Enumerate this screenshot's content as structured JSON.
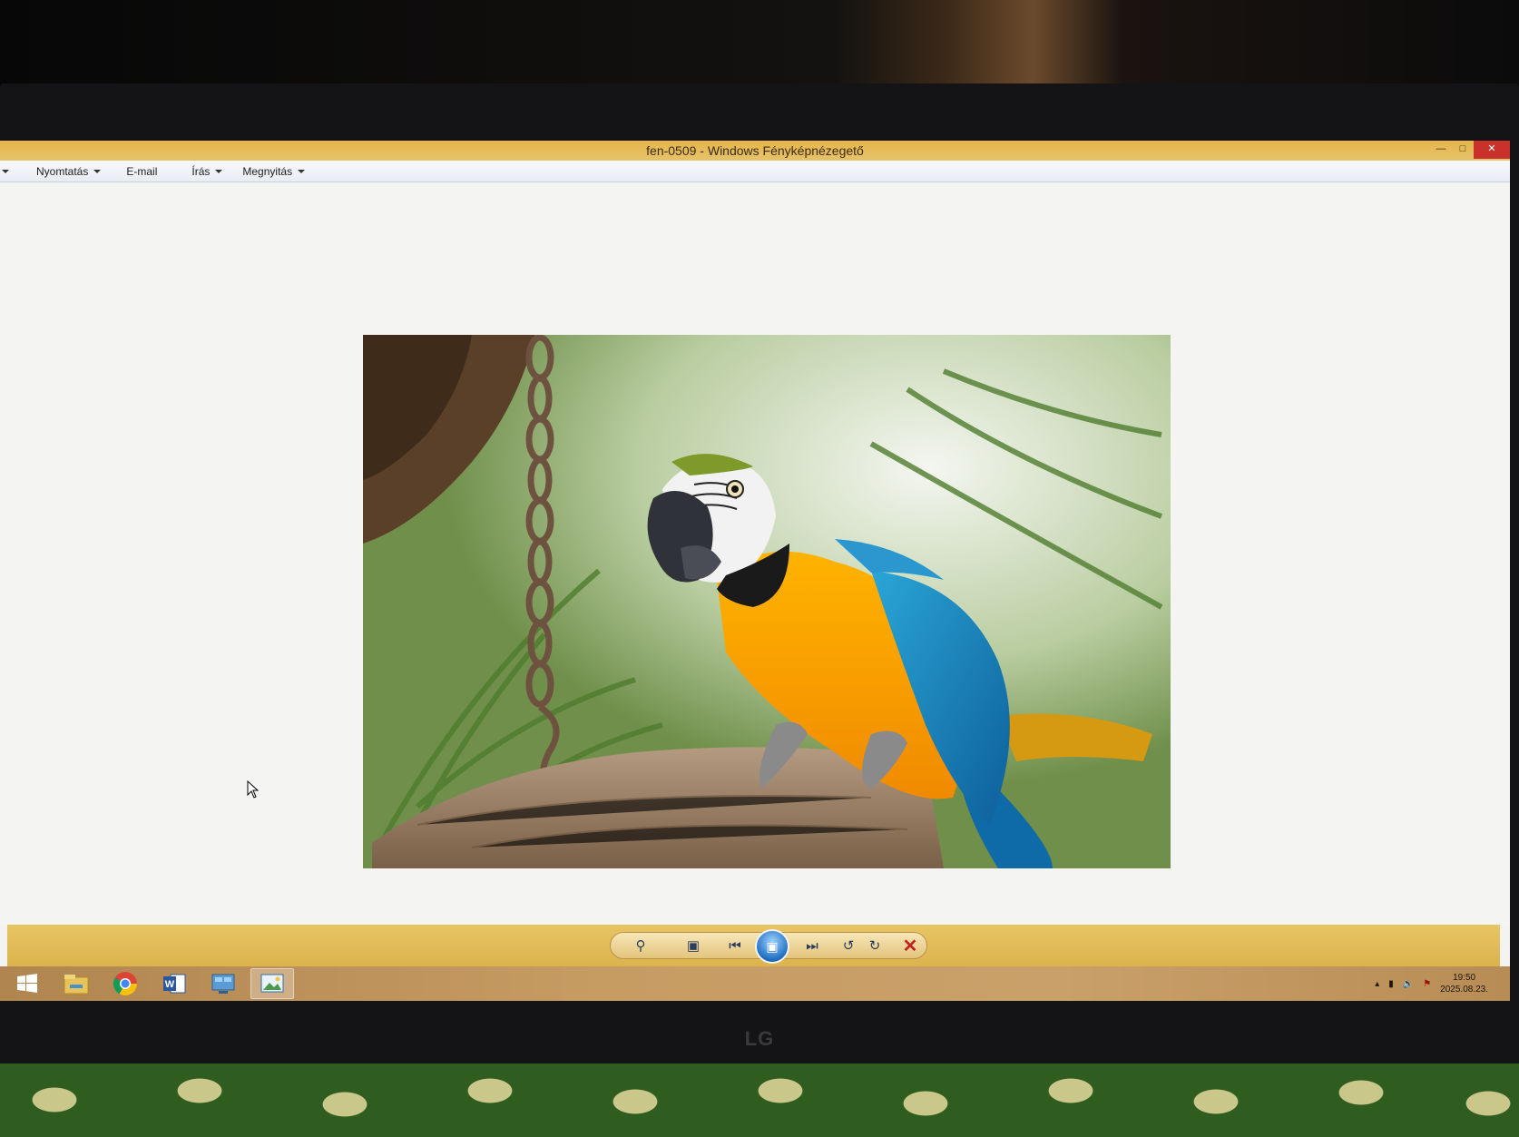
{
  "window": {
    "title": "fen-0509 - Windows Fényképnézegető"
  },
  "menu": {
    "items": [
      {
        "label": "Nyomtatás",
        "has_dropdown": true
      },
      {
        "label": "E-mail",
        "has_dropdown": false
      },
      {
        "label": "Írás",
        "has_dropdown": true
      },
      {
        "label": "Megnyitás",
        "has_dropdown": true
      }
    ]
  },
  "photo": {
    "subject": "blue-and-yellow macaw on wooden perch"
  },
  "controls": [
    {
      "name": "zoom-button",
      "icon": "magnifier-icon"
    },
    {
      "name": "fit-to-window-button",
      "icon": "fit-icon"
    },
    {
      "name": "previous-button",
      "icon": "skip-previous-icon"
    },
    {
      "name": "slideshow-button",
      "icon": "slideshow-icon"
    },
    {
      "name": "next-button",
      "icon": "skip-next-icon"
    },
    {
      "name": "rotate-ccw-button",
      "icon": "rotate-left-icon"
    },
    {
      "name": "rotate-cw-button",
      "icon": "rotate-right-icon"
    },
    {
      "name": "delete-button",
      "icon": "delete-x-icon"
    }
  ],
  "taskbar": {
    "apps": [
      "start-icon",
      "file-explorer-icon",
      "chrome-icon",
      "word-icon",
      "control-panel-icon",
      "photo-viewer-icon"
    ],
    "clock_time": "19:50",
    "clock_date": "2025.08.23."
  },
  "monitor": {
    "brand": "LG"
  },
  "colors": {
    "accent": "#e3b84f",
    "close": "#c9322b",
    "viewer_bg": "#f4f4f2"
  }
}
